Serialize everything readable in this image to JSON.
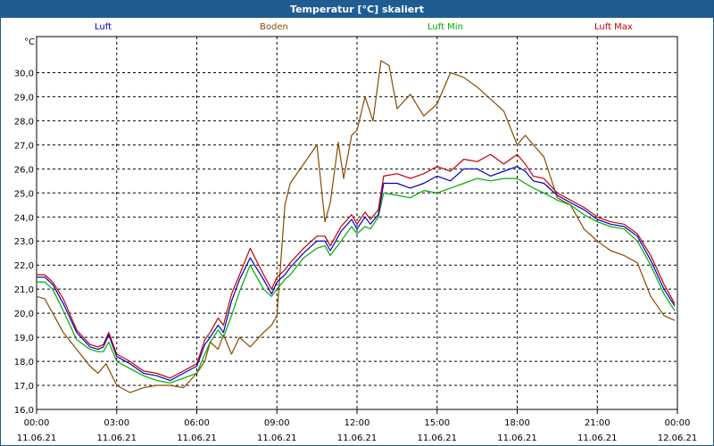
{
  "window": {
    "title": "Temperatur [°C] skaliert"
  },
  "colors": {
    "titlebar": "#1f5c92",
    "grid": "#000000"
  },
  "chart_data": {
    "type": "line",
    "title": "Temperatur [°C] skaliert",
    "ylabel": "°C",
    "xlabel": "",
    "ylim": [
      16.0,
      31.5
    ],
    "xlim": [
      0,
      24
    ],
    "grid": true,
    "legend_position": "top",
    "yticks": [
      "16,0",
      "17,0",
      "18,0",
      "19,0",
      "20,0",
      "21,0",
      "22,0",
      "23,0",
      "24,0",
      "25,0",
      "26,0",
      "27,0",
      "28,0",
      "29,0",
      "30,0"
    ],
    "xticks": [
      {
        "time": "00:00",
        "date": "11.06.21"
      },
      {
        "time": "03:00",
        "date": "11.06.21"
      },
      {
        "time": "06:00",
        "date": "11.06.21"
      },
      {
        "time": "09:00",
        "date": "11.06.21"
      },
      {
        "time": "12:00",
        "date": "11.06.21"
      },
      {
        "time": "15:00",
        "date": "11.06.21"
      },
      {
        "time": "18:00",
        "date": "11.06.21"
      },
      {
        "time": "21:00",
        "date": "11.06.21"
      },
      {
        "time": "00:00",
        "date": "12.06.21"
      }
    ],
    "series": [
      {
        "name": "Luft",
        "color": "#0000c0",
        "x": [
          0,
          0.3,
          0.6,
          1,
          1.5,
          2,
          2.3,
          2.5,
          2.7,
          3,
          3.5,
          4,
          4.5,
          5,
          5.5,
          6,
          6.3,
          6.5,
          6.8,
          7,
          7.3,
          7.6,
          8,
          8.5,
          8.8,
          9,
          9.3,
          9.5,
          10,
          10.5,
          10.8,
          11,
          11.4,
          11.8,
          12,
          12.3,
          12.5,
          12.8,
          13,
          13.5,
          14,
          14.5,
          15,
          15.5,
          16,
          16.5,
          17,
          17.5,
          18,
          18.3,
          18.6,
          19,
          19.5,
          20,
          20.5,
          21,
          21.5,
          22,
          22.5,
          23,
          23.5,
          23.9
        ],
        "y": [
          21.5,
          21.5,
          21.2,
          20.4,
          19.2,
          18.6,
          18.5,
          18.6,
          19.1,
          18.2,
          17.9,
          17.5,
          17.4,
          17.2,
          17.5,
          17.8,
          18.7,
          19.0,
          19.5,
          19.2,
          20.5,
          21.4,
          22.3,
          21.4,
          20.8,
          21.3,
          21.6,
          21.9,
          22.5,
          23.0,
          23.0,
          22.6,
          23.4,
          23.9,
          23.5,
          24.0,
          23.7,
          24.1,
          25.4,
          25.4,
          25.2,
          25.4,
          25.7,
          25.5,
          26.0,
          26.0,
          25.7,
          25.9,
          26.1,
          25.9,
          25.5,
          25.4,
          24.9,
          24.6,
          24.3,
          23.9,
          23.7,
          23.6,
          23.2,
          22.2,
          21.0,
          20.3
        ]
      },
      {
        "name": "Boden",
        "color": "#8b4a00",
        "x": [
          0,
          0.3,
          0.6,
          1,
          1.5,
          2,
          2.3,
          2.6,
          3,
          3.5,
          4,
          4.5,
          5,
          5.5,
          6,
          6.3,
          6.5,
          6.8,
          7,
          7.3,
          7.6,
          8,
          8.5,
          8.8,
          9,
          9.3,
          9.5,
          10,
          10.5,
          10.8,
          11,
          11.3,
          11.5,
          11.8,
          12,
          12.3,
          12.6,
          12.9,
          13.2,
          13.5,
          14,
          14.5,
          15,
          15.5,
          16,
          16.5,
          17,
          17.5,
          18,
          18.3,
          18.6,
          19,
          19.5,
          20,
          20.5,
          21,
          21.5,
          22,
          22.5,
          23,
          23.5,
          23.9
        ],
        "y": [
          20.7,
          20.6,
          20.0,
          19.2,
          18.5,
          17.8,
          17.5,
          17.9,
          17.0,
          16.7,
          16.9,
          17.0,
          17.0,
          16.9,
          17.5,
          18.0,
          18.8,
          18.5,
          19.1,
          18.3,
          19.0,
          18.6,
          19.2,
          19.5,
          19.9,
          24.5,
          25.4,
          26.2,
          27.0,
          23.8,
          24.6,
          27.1,
          25.6,
          27.4,
          27.6,
          29.0,
          28.0,
          30.5,
          30.3,
          28.5,
          29.1,
          28.2,
          28.7,
          30.0,
          29.8,
          29.4,
          28.9,
          28.4,
          27.0,
          27.4,
          27.0,
          26.5,
          24.8,
          24.5,
          23.5,
          23.0,
          22.6,
          22.4,
          22.1,
          20.7,
          19.9,
          19.7
        ]
      },
      {
        "name": "Luft Min",
        "color": "#00aa00",
        "x": [
          0,
          0.3,
          0.6,
          1,
          1.5,
          2,
          2.3,
          2.5,
          2.7,
          3,
          3.5,
          4,
          4.5,
          5,
          5.5,
          6,
          6.3,
          6.5,
          6.8,
          7,
          7.3,
          7.6,
          8,
          8.5,
          8.8,
          9,
          9.3,
          9.5,
          10,
          10.5,
          10.8,
          11,
          11.4,
          11.8,
          12,
          12.3,
          12.5,
          12.8,
          13,
          13.5,
          14,
          14.5,
          15,
          15.5,
          16,
          16.5,
          17,
          17.5,
          18,
          18.3,
          18.6,
          19,
          19.5,
          20,
          20.5,
          21,
          21.5,
          22,
          22.5,
          23,
          23.5,
          23.9
        ],
        "y": [
          21.3,
          21.3,
          21.0,
          20.1,
          18.9,
          18.5,
          18.4,
          18.4,
          18.8,
          18.0,
          17.7,
          17.4,
          17.2,
          17.1,
          17.3,
          17.5,
          18.3,
          18.8,
          19.3,
          19.0,
          19.9,
          20.9,
          22.0,
          21.0,
          20.7,
          21.0,
          21.4,
          21.6,
          22.3,
          22.7,
          22.8,
          22.4,
          23.0,
          23.6,
          23.3,
          23.6,
          23.5,
          24.0,
          25.0,
          24.9,
          24.8,
          25.1,
          25.0,
          25.2,
          25.4,
          25.6,
          25.5,
          25.6,
          25.6,
          25.4,
          25.2,
          25.0,
          24.7,
          24.5,
          24.1,
          23.8,
          23.6,
          23.5,
          23.0,
          22.0,
          20.8,
          20.1
        ]
      },
      {
        "name": "Luft Max",
        "color": "#c00000",
        "x": [
          0,
          0.3,
          0.6,
          1,
          1.5,
          2,
          2.3,
          2.5,
          2.7,
          3,
          3.5,
          4,
          4.5,
          5,
          5.5,
          6,
          6.3,
          6.5,
          6.8,
          7,
          7.3,
          7.6,
          8,
          8.5,
          8.8,
          9,
          9.3,
          9.5,
          10,
          10.5,
          10.8,
          11,
          11.4,
          11.8,
          12,
          12.3,
          12.5,
          12.8,
          13,
          13.5,
          14,
          14.5,
          15,
          15.5,
          16,
          16.5,
          17,
          17.5,
          18,
          18.3,
          18.6,
          19,
          19.5,
          20,
          20.5,
          21,
          21.5,
          22,
          22.5,
          23,
          23.5,
          23.9
        ],
        "y": [
          21.6,
          21.6,
          21.3,
          20.6,
          19.3,
          18.7,
          18.6,
          18.7,
          19.2,
          18.3,
          18.0,
          17.6,
          17.5,
          17.3,
          17.6,
          17.9,
          18.9,
          19.2,
          19.8,
          19.5,
          20.8,
          21.6,
          22.7,
          21.6,
          21.0,
          21.5,
          21.8,
          22.1,
          22.7,
          23.2,
          23.2,
          22.8,
          23.6,
          24.1,
          23.7,
          24.2,
          23.9,
          24.3,
          25.7,
          25.8,
          25.6,
          25.8,
          26.1,
          25.9,
          26.4,
          26.3,
          26.6,
          26.2,
          26.6,
          26.2,
          25.7,
          25.6,
          25.0,
          24.7,
          24.4,
          24.0,
          23.8,
          23.7,
          23.3,
          22.4,
          21.2,
          20.4
        ]
      }
    ]
  }
}
